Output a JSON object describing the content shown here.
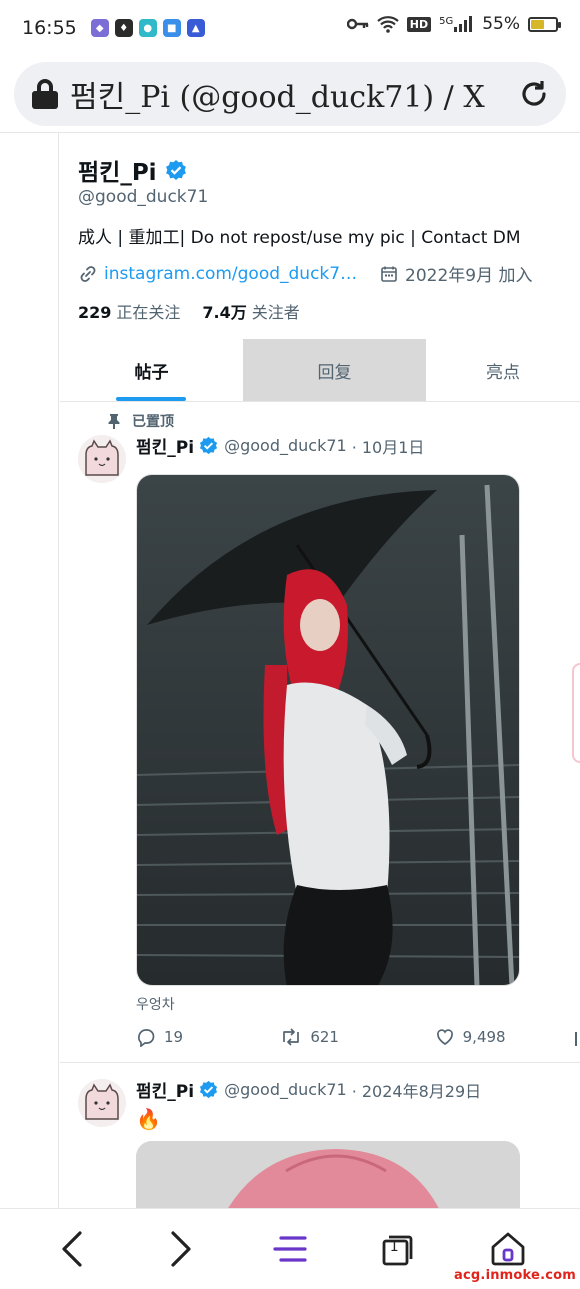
{
  "status_bar": {
    "time": "16:55",
    "network": "5G",
    "hd_badge": "HD",
    "battery_text": "55%",
    "battery_level": 0.55,
    "app_icons": [
      "notification-app-1-icon",
      "notification-app-2-icon",
      "notification-app-3-icon",
      "notification-app-4-icon",
      "notification-app-5-icon"
    ]
  },
  "browser": {
    "page_title": "펌킨_Pi (@good_duck71) / X"
  },
  "profile": {
    "name": "펌킨_Pi",
    "handle": "@good_duck71",
    "bio": "成人 | 重加工| Do not repost/use my pic | Contact DM",
    "link": "instagram.com/good_duck71?ig...",
    "joined": "2022年9月 加入",
    "following_count": "229",
    "following_label": "正在关注",
    "followers_count": "7.4万",
    "followers_label": "关注者"
  },
  "tabs": [
    {
      "label": "帖子"
    },
    {
      "label": "回复"
    },
    {
      "label": "亮点"
    }
  ],
  "pinned_label": "已置顶",
  "posts": [
    {
      "name": "펌킨_Pi",
      "handle": "@good_duck71",
      "date": "· 10月1日",
      "caption": "우엉차",
      "replies": "19",
      "reposts": "621",
      "likes": "9,498"
    },
    {
      "name": "펌킨_Pi",
      "handle": "@good_duck71",
      "date": "· 2024年8月29日",
      "text": "🔥"
    }
  ],
  "bottom_nav": {
    "tab_count": "1"
  },
  "watermark": "acg.inmoke.com",
  "colors": {
    "accent": "#1d9bf0",
    "text": "#0f1419",
    "secondary": "#536471",
    "nav_menu": "#6a35c9"
  }
}
